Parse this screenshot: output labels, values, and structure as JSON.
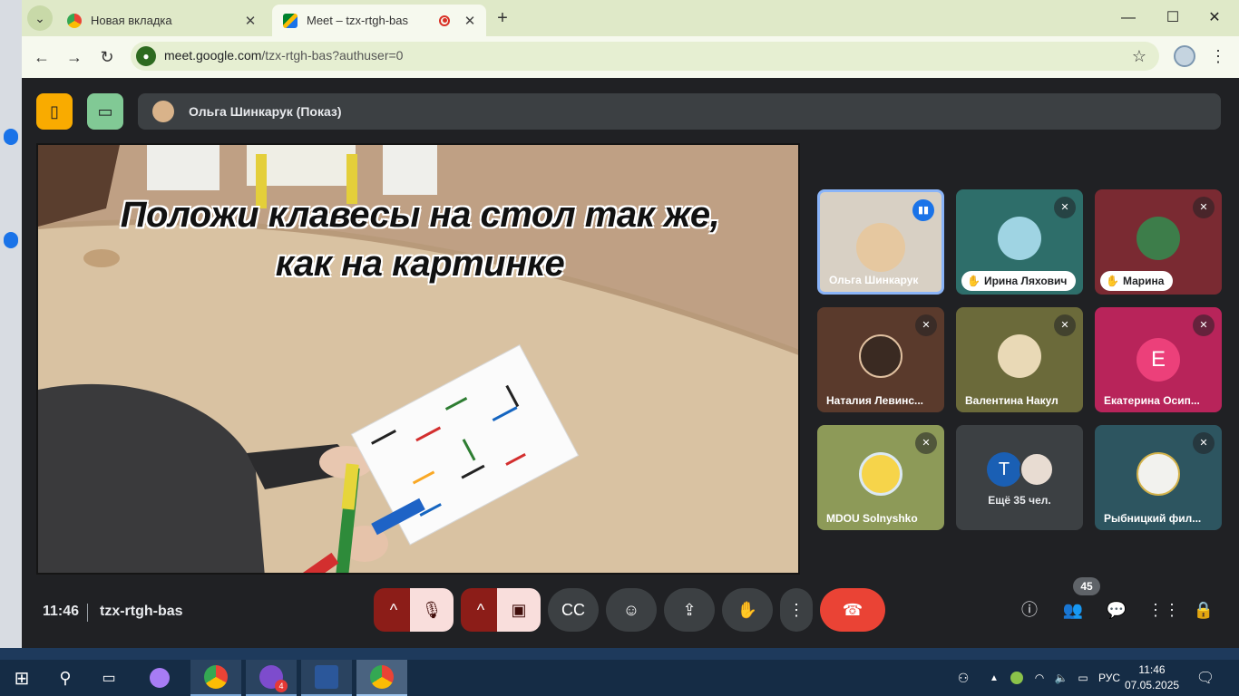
{
  "browser": {
    "tabs": [
      {
        "title": "Новая вкладка",
        "active": false
      },
      {
        "title": "Meet – tzx-rtgh-bas",
        "active": true
      }
    ],
    "url_domain": "meet.google.com",
    "url_path": "/tzx-rtgh-bas?authuser=0"
  },
  "meet": {
    "presenter_label": "Ольга Шинкарук (Показ)",
    "caption_line1": "Положи клавесы на стол так же,",
    "caption_line2": "как на картинке",
    "participants": [
      {
        "name": "Ольга Шинкарук",
        "state": "speaking"
      },
      {
        "name": "Ирина Ляхович",
        "state": "hand-raised, muted"
      },
      {
        "name": "Марина",
        "state": "hand-raised, muted"
      },
      {
        "name": "Наталия Левинс...",
        "state": "muted"
      },
      {
        "name": "Валентина Накул",
        "state": "muted"
      },
      {
        "name": "Екатерина Осип...",
        "initial": "Е",
        "state": "muted"
      },
      {
        "name": "MDOU Solnyshko",
        "state": "muted"
      },
      {
        "name": "Ещё 35 чел.",
        "initial": "Т"
      },
      {
        "name": "Рыбницкий фил...",
        "state": "muted"
      }
    ],
    "time": "11:46",
    "meeting_code": "tzx-rtgh-bas",
    "people_count": "45"
  },
  "taskbar": {
    "viber_badge": "4",
    "lang": "РУС",
    "time": "11:46",
    "date": "07.05.2025"
  },
  "colors": {
    "meet_bg": "#202124",
    "accent_yellow": "#f9ab00",
    "accent_green": "#81c995",
    "end_call": "#ea4335",
    "tabbar": "#dfe9c8"
  }
}
